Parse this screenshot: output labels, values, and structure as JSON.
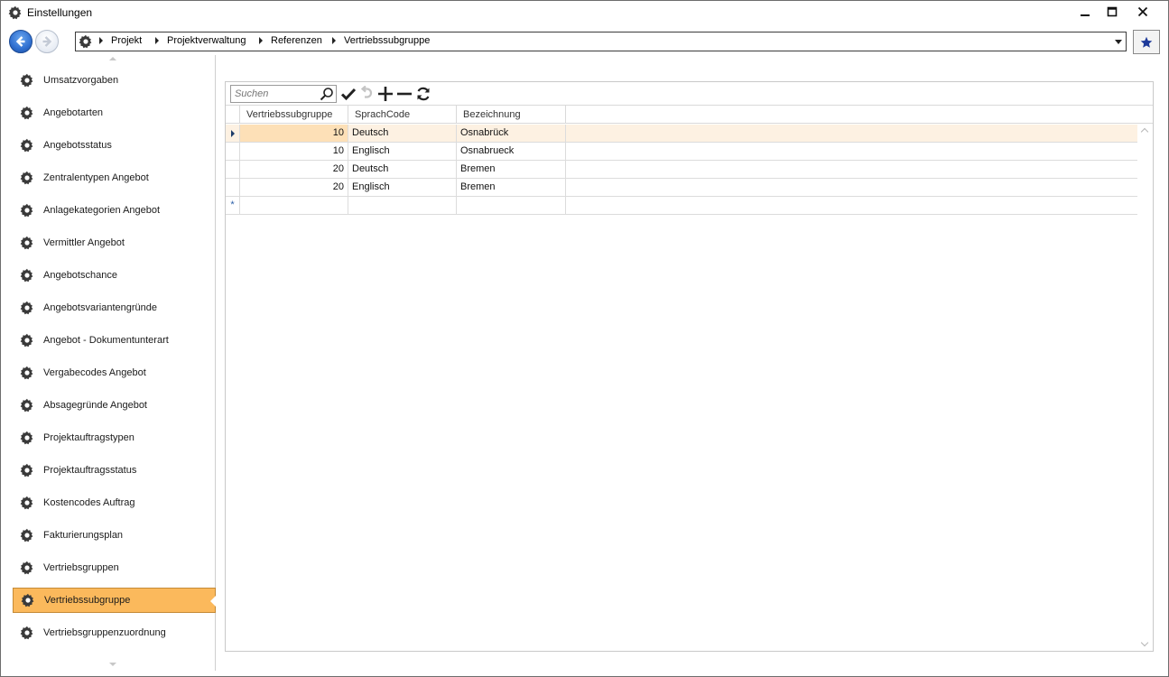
{
  "window": {
    "title": "Einstellungen"
  },
  "breadcrumb": {
    "items": [
      "Projekt",
      "Projektverwaltung",
      "Referenzen",
      "Vertriebssubgruppe"
    ]
  },
  "sidebar": {
    "items": [
      {
        "label": "Umsatzvorgaben"
      },
      {
        "label": "Angebotarten"
      },
      {
        "label": "Angebotsstatus"
      },
      {
        "label": "Zentralentypen Angebot"
      },
      {
        "label": "Anlagekategorien Angebot"
      },
      {
        "label": "Vermittler Angebot"
      },
      {
        "label": "Angebotschance"
      },
      {
        "label": "Angebotsvariantengründe"
      },
      {
        "label": "Angebot - Dokumentunterart"
      },
      {
        "label": "Vergabecodes Angebot"
      },
      {
        "label": "Absagegründe Angebot"
      },
      {
        "label": "Projektauftragstypen"
      },
      {
        "label": "Projektauftragsstatus"
      },
      {
        "label": "Kostencodes Auftrag"
      },
      {
        "label": "Fakturierungsplan"
      },
      {
        "label": "Vertriebsgruppen"
      },
      {
        "label": "Vertriebssubgruppe",
        "active": true
      },
      {
        "label": "Vertriebsgruppenzuordnung"
      }
    ]
  },
  "toolbar": {
    "search_placeholder": "Suchen"
  },
  "grid": {
    "columns": [
      "Vertriebssubgruppe",
      "SprachCode",
      "Bezeichnung"
    ],
    "rows": [
      {
        "vertriebssubgruppe": "10",
        "sprachcode": "Deutsch",
        "bezeichnung": "Osnabrück"
      },
      {
        "vertriebssubgruppe": "10",
        "sprachcode": "Englisch",
        "bezeichnung": "Osnabrueck"
      },
      {
        "vertriebssubgruppe": "20",
        "sprachcode": "Deutsch",
        "bezeichnung": "Bremen"
      },
      {
        "vertriebssubgruppe": "20",
        "sprachcode": "Englisch",
        "bezeichnung": "Bremen"
      }
    ],
    "new_row_marker": "*"
  },
  "colors": {
    "active_item": "#fbb95c",
    "selected_row": "#fdf1e2",
    "selected_key_cell": "#fde0b7",
    "favorite_star": "#1e3a9a"
  }
}
